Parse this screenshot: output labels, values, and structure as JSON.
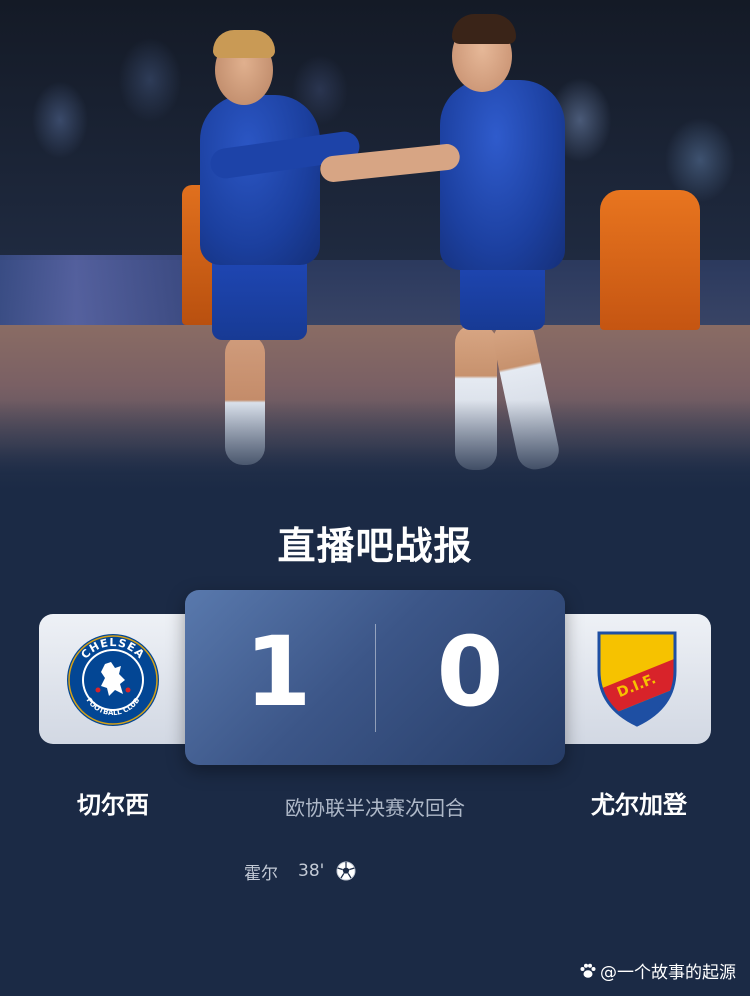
{
  "header": {
    "title_part1": "直播吧战",
    "title_accent": "",
    "title_part2": "报"
  },
  "match": {
    "home_team": "切尔西",
    "away_team": "尤尔加登",
    "home_score": "1",
    "away_score": "0",
    "competition_round": "欧协联半决赛次回合",
    "home_crest_text_top": "CHELSEA",
    "home_crest_text_bottom": "FOOTBALL CLUB",
    "away_crest_text": "D.I.F."
  },
  "goals": [
    {
      "player": "霍尔",
      "minute": "38'",
      "icon": "football-icon"
    }
  ],
  "watermark": {
    "text": "@一个故事的起源",
    "icon": "paw-icon"
  },
  "colors": {
    "background": "#1b2a45",
    "score_panel": "#3c5688",
    "accent": "#42e2c4",
    "chelsea_blue": "#034694",
    "djurgarden_red": "#d8232a",
    "djurgarden_yellow": "#f6c200",
    "djurgarden_blue": "#1e4fa3"
  }
}
